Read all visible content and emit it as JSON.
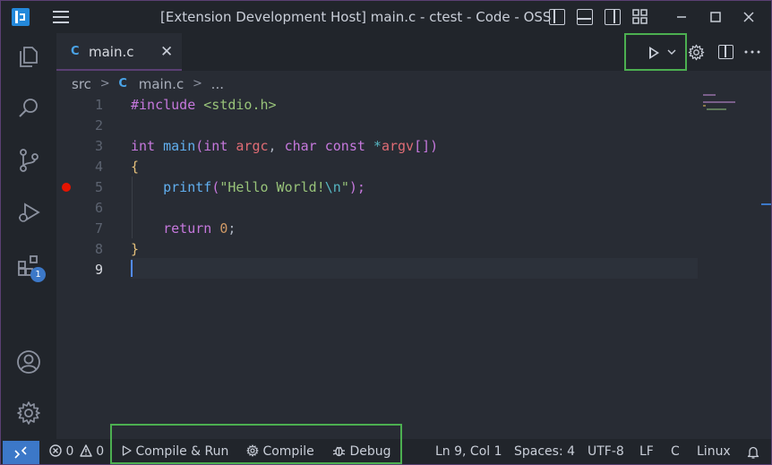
{
  "titlebar": {
    "title": "[Extension Development Host] main.c - ctest - Code - OSS"
  },
  "activity_bar": {
    "extensions_badge": "1"
  },
  "tab": {
    "icon_letter": "C",
    "label": "main.c",
    "close_glyph": "✕"
  },
  "breadcrumb": {
    "folder": "src",
    "file_icon": "C",
    "file": "main.c",
    "more": "..."
  },
  "editor": {
    "line_numbers": [
      "1",
      "2",
      "3",
      "4",
      "5",
      "6",
      "7",
      "8",
      "9"
    ],
    "breakpoint_line": 5,
    "cursor": {
      "line": 9,
      "col": 1
    }
  },
  "code": {
    "l1_directive": "#include",
    "l1_header": " <stdio.h>",
    "l3_type": "int",
    "l3_fn": " main",
    "l3_paren": "(",
    "l3_type2": "int",
    "l3_arg1": " argc",
    "l3_comma": ", ",
    "l3_char": "char",
    "l3_const": " const",
    "l3_star": " *",
    "l3_argv": "argv",
    "l3_close": "[])",
    "l4_brace": "{",
    "l5_indent": "    ",
    "l5_fn": "printf",
    "l5_open": "(",
    "l5_str": "\"Hello World!",
    "l5_esc": "\\n",
    "l5_strend": "\"",
    "l5_close": ");",
    "l7_indent": "    ",
    "l7_kw": "return",
    "l7_num": " 0",
    "l7_semi": ";",
    "l8_brace": "}"
  },
  "statusbar": {
    "errors": "0",
    "warnings": "0",
    "compile_run": "Compile & Run",
    "compile": "Compile",
    "debug": "Debug",
    "position": "Ln 9, Col 1",
    "spaces": "Spaces: 4",
    "encoding": "UTF-8",
    "eol": "LF",
    "language": "C",
    "platform": "Linux"
  },
  "colors": {
    "accent": "#3c78c8",
    "highlight_box": "#4caf50",
    "breakpoint": "#e51400",
    "background": "#282c34",
    "chrome": "#21252b"
  },
  "icons": [
    "app-logo-icon",
    "menu-icon",
    "explorer-icon",
    "search-icon",
    "source-control-icon",
    "run-debug-icon",
    "extensions-icon",
    "account-icon",
    "settings-gear-icon",
    "run-icon",
    "chevron-down-icon",
    "split-editor-icon",
    "more-actions-icon",
    "remote-icon",
    "error-icon",
    "warning-icon",
    "play-icon",
    "gear-icon",
    "bug-icon",
    "bell-icon"
  ]
}
